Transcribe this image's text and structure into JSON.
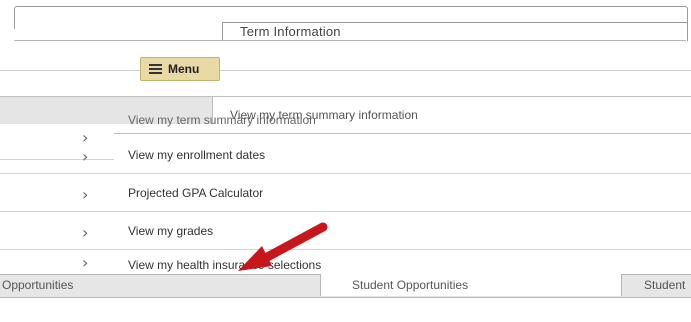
{
  "header": {
    "term_title": "Term Information"
  },
  "menu": {
    "label": "Menu"
  },
  "tabs": {
    "term_summary": "View my term summary information"
  },
  "list": {
    "items": [
      {
        "label": "View my term summary information"
      },
      {
        "label": "View my enrollment dates"
      },
      {
        "label": "Projected GPA Calculator"
      },
      {
        "label": "View my grades"
      },
      {
        "label": "View my health insurance selections"
      }
    ]
  },
  "bottom": {
    "left_label": "Opportunities",
    "middle_label": "Student Opportunities",
    "right_label": "Student"
  },
  "colors": {
    "menu_button": "#e9d9a6",
    "arrow": "#c8161d"
  }
}
